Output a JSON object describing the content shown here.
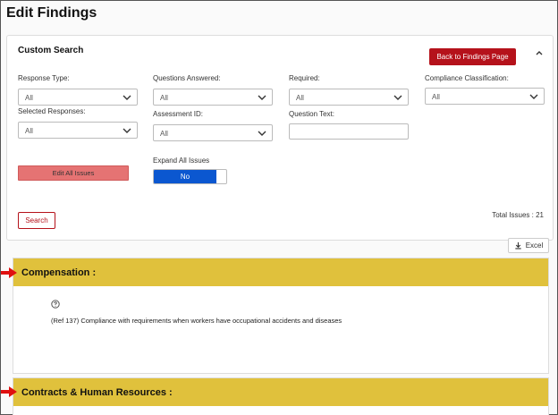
{
  "page": {
    "title": "Edit Findings"
  },
  "custom_search": {
    "title": "Custom Search",
    "back_button": "Back to Findings Page",
    "fields": {
      "response_type": {
        "label": "Response Type:",
        "value": "All"
      },
      "questions_answered": {
        "label": "Questions Answered:",
        "value": "All"
      },
      "required": {
        "label": "Required:",
        "value": "All"
      },
      "compliance_classification": {
        "label": "Compliance Classification:",
        "value": "All"
      },
      "selected_responses": {
        "label": "Selected Responses:",
        "value": "All"
      },
      "assessment_id": {
        "label": "Assessment ID:",
        "value": "All"
      },
      "question_text": {
        "label": "Question Text:",
        "value": ""
      }
    },
    "edit_all_label": "Edit All Issues",
    "expand_all": {
      "label": "Expand All Issues",
      "value": "No"
    },
    "search_button": "Search",
    "total_issues": "Total Issues : 21"
  },
  "excel_button": "Excel",
  "sections": [
    {
      "title": "Compensation :",
      "findings": [
        "(Ref 137) Compliance with requirements when workers have occupational accidents and diseases"
      ]
    },
    {
      "title": "Contracts & Human Resources :"
    }
  ],
  "colors": {
    "accent_red": "#b5121b",
    "section_yellow": "#e0c13c",
    "toggle_blue": "#0b57d0",
    "arrow_red": "#e01010"
  },
  "icons": [
    "chevron-up-icon",
    "chevron-down-icon",
    "download-icon",
    "help-circle-icon",
    "arrow-right-icon"
  ]
}
